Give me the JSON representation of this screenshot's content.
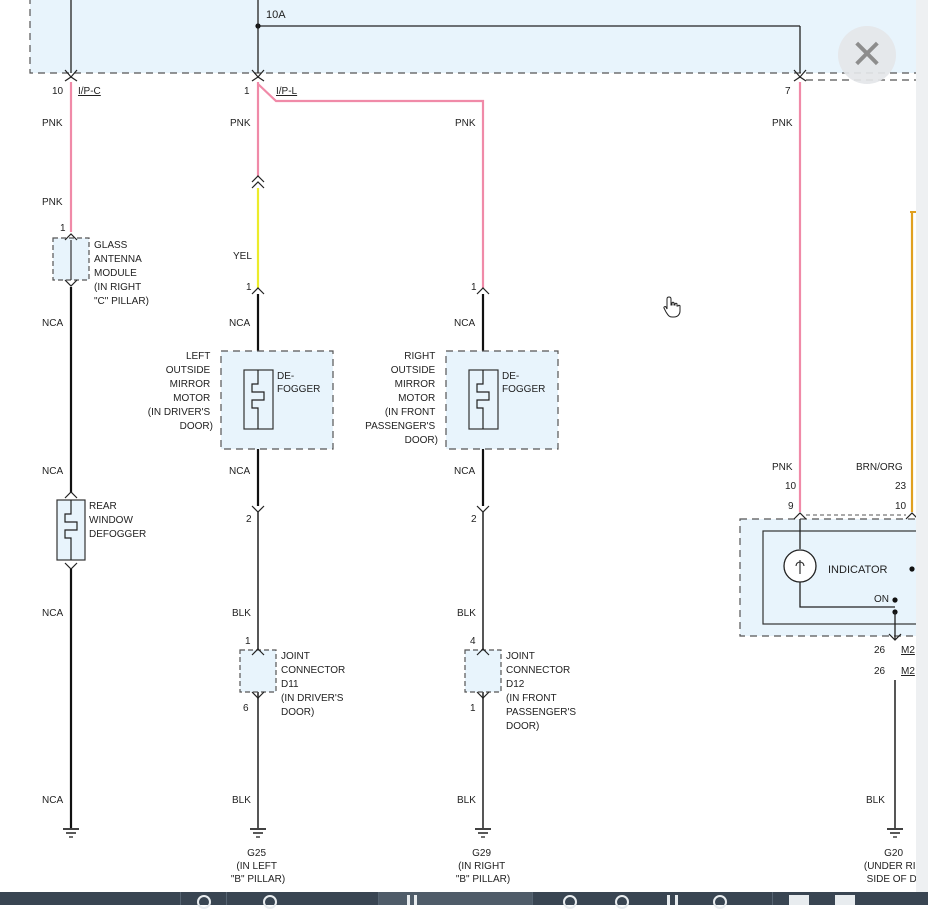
{
  "diagram": {
    "fuse_rating": "10A",
    "connectors": [
      {
        "pin": "10",
        "code": "I/P-C"
      },
      {
        "pin": "1",
        "code": "I/P-L"
      },
      {
        "pin": "7",
        "code": ""
      }
    ],
    "wire_colors": {
      "pnk": "PNK",
      "yel": "YEL",
      "nca": "NCA",
      "blk": "BLK",
      "brn_org": "BRN/ORG"
    },
    "glass_antenna": {
      "pin": "1",
      "lines": [
        "GLASS",
        "ANTENNA",
        "MODULE",
        "(IN RIGHT",
        "\"C\" PILLAR)"
      ]
    },
    "rear_defogger": {
      "lines": [
        "REAR",
        "WINDOW",
        "DEFOGGER"
      ]
    },
    "left_mirror": {
      "pin_top": "1",
      "pin_bottom": "2",
      "lines": [
        "LEFT",
        "OUTSIDE",
        "MIRROR",
        "MOTOR",
        "(IN DRIVER'S",
        "DOOR)"
      ],
      "component_lines": [
        "DE-",
        "FOGGER"
      ]
    },
    "right_mirror": {
      "pin_top": "1",
      "pin_bottom": "2",
      "lines": [
        "RIGHT",
        "OUTSIDE",
        "MIRROR",
        "MOTOR",
        "(IN FRONT",
        "PASSENGER'S",
        "DOOR)"
      ],
      "component_lines": [
        "DE-",
        "FOGGER"
      ]
    },
    "joint_d11": {
      "pin_top": "1",
      "pin_bottom": "6",
      "lines": [
        "JOINT",
        "CONNECTOR",
        "D11",
        "(IN DRIVER'S",
        "DOOR)"
      ]
    },
    "joint_d12": {
      "pin_top": "4",
      "pin_bottom": "1",
      "lines": [
        "JOINT",
        "CONNECTOR",
        "D12",
        "(IN FRONT",
        "PASSENGER'S",
        "DOOR)"
      ]
    },
    "grounds": [
      {
        "id": "G25",
        "lines": [
          "G25",
          "(IN LEFT",
          "\"B\" PILLAR)"
        ]
      },
      {
        "id": "G29",
        "lines": [
          "G29",
          "(IN RIGHT",
          "\"B\" PILLAR)"
        ]
      },
      {
        "id": "G20",
        "lines": [
          "G20",
          "(UNDER RIG",
          "SIDE OF DA"
        ]
      }
    ],
    "switch": {
      "indicator": "INDICATOR",
      "on": "ON",
      "pins": {
        "a": "10",
        "b": "23",
        "c": "9",
        "d": "10"
      },
      "bottom_pins": [
        "26",
        "26"
      ],
      "bottom_codes": [
        "M2",
        "M2"
      ]
    },
    "colors": {
      "pink": "#f08aa8",
      "yellow": "#ecec2a",
      "orange": "#e0a020",
      "fill": "#e8f4fc",
      "black": "#111111"
    }
  },
  "ui": {
    "close_symbol": "✕"
  }
}
